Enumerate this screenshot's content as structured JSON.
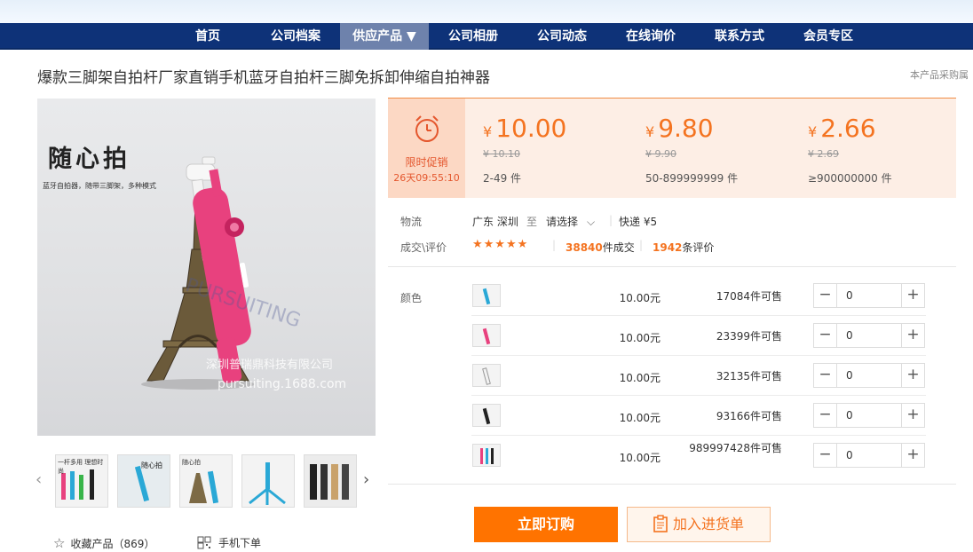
{
  "nav": {
    "items": [
      {
        "label": "首页",
        "active": false
      },
      {
        "label": "公司档案",
        "active": false
      },
      {
        "label": "供应产品 ▼",
        "active": true
      },
      {
        "label": "公司相册",
        "active": false
      },
      {
        "label": "公司动态",
        "active": false
      },
      {
        "label": "在线询价",
        "active": false
      },
      {
        "label": "联系方式",
        "active": false
      },
      {
        "label": "会员专区",
        "active": false
      }
    ]
  },
  "product": {
    "title": "爆款三脚架自拍杆厂家直销手机蓝牙自拍杆三脚免拆卸伸缩自拍神器",
    "side_note": "本产品采购属"
  },
  "gallery": {
    "main_image": {
      "headline": "随心拍",
      "subline": "蓝牙自拍器，随带三脚架，多种模式",
      "watermark_company": "深圳普瑞鼎科技有限公司",
      "watermark_site": "pursuiting.1688.com"
    },
    "thumb_captions": [
      "一杆多用 理想时尚",
      "",
      "随心拍",
      "",
      ""
    ],
    "prev_icon": "‹",
    "next_icon": "›"
  },
  "promo": {
    "label": "限时促销",
    "countdown": "26天09:55:10",
    "currency": "¥",
    "tiers": [
      {
        "price": "10.00",
        "old_price": "10.10",
        "range": "2-49 件"
      },
      {
        "price": "9.80",
        "old_price": "9.90",
        "range": "50-899999999 件"
      },
      {
        "price": "2.66",
        "old_price": "2.69",
        "range": "≥900000000 件"
      }
    ]
  },
  "logistics": {
    "label": "物流",
    "from": "广东 深圳",
    "to_word": "至",
    "destination": "请选择",
    "shipping": "快递 ¥5"
  },
  "reviews": {
    "label": "成交\\评价",
    "stars": "★★★★★",
    "rating": 5,
    "deals": "38840",
    "deals_unit": "件成交",
    "reviews": "1942",
    "reviews_unit": "条评价"
  },
  "sku": {
    "label": "颜色",
    "rows": [
      {
        "price": "10.00元",
        "stock": "17084件可售",
        "qty": "0"
      },
      {
        "price": "10.00元",
        "stock": "23399件可售",
        "qty": "0"
      },
      {
        "price": "10.00元",
        "stock": "32135件可售",
        "qty": "0"
      },
      {
        "price": "10.00元",
        "stock": "93166件可售",
        "qty": "0"
      },
      {
        "price": "10.00元",
        "stock": "989997428件可售",
        "qty": "0"
      }
    ],
    "minus": "−",
    "plus": "+"
  },
  "actions": {
    "buy": "立即订购",
    "cart": "加入进货单",
    "favorite": "收藏产品（869）",
    "mobile_order": "手机下单"
  },
  "colors": {
    "nav_bg": "#0e3278",
    "accent": "#f47320",
    "buy_bg": "#ff7300"
  }
}
